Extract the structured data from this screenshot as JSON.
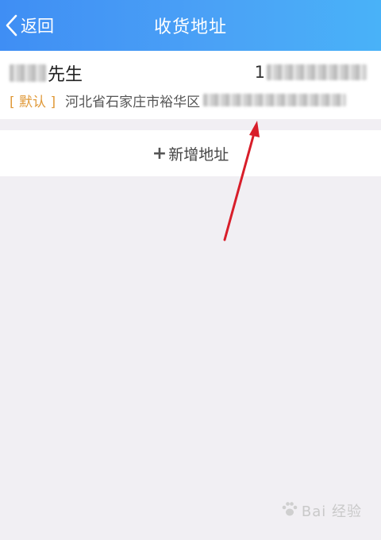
{
  "header": {
    "back_label": "返回",
    "title": "收货地址"
  },
  "address": {
    "name": "先生",
    "phone_prefix": "1",
    "default_tag": "[ 默认 ]",
    "address_text": "河北省石家庄市裕华区"
  },
  "add_button": {
    "plus": "+",
    "label": "新增地址"
  },
  "watermark": {
    "text": "Bai 经验"
  },
  "colors": {
    "header_start": "#3f8ef4",
    "header_end": "#49b2f8",
    "default_tag": "#e09a3a",
    "arrow": "#d81e2a",
    "background": "#f1eff3"
  }
}
